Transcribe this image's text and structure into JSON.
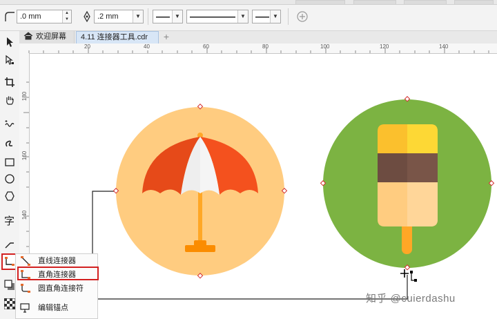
{
  "property_bar": {
    "corner_size": ".0 mm",
    "outline_width": ".2 mm"
  },
  "tabs": [
    {
      "label": "欢迎屏幕"
    },
    {
      "label": "4.11 连接器工具.cdr"
    }
  ],
  "ruler": {
    "h_labels": [
      "20",
      "40",
      "60",
      "80",
      "100",
      "120",
      "140"
    ],
    "v_labels": [
      "180",
      "160",
      "140"
    ]
  },
  "toolbox": {
    "tools": [
      "pick-tool",
      "shape-tool",
      "crop-tool",
      "pan-tool",
      "freehand-tool",
      "artistic-media-tool",
      "rectangle-tool",
      "ellipse-tool",
      "polygon-tool",
      "text-tool",
      "dimension-tool",
      "connector-tool",
      "drop-shadow-tool",
      "transparency-tool"
    ]
  },
  "flyout": {
    "items": [
      {
        "label": "直线连接器"
      },
      {
        "label": "直角连接器"
      },
      {
        "label": "圆直角连接符"
      },
      {
        "label": "编辑锚点"
      }
    ]
  },
  "colors": {
    "umbrella_bg": "#ffcc80",
    "popsicle_bg": "#7cb342",
    "connector_line": "#222222",
    "highlight": "#d21f1f"
  },
  "watermark": "知乎 @cuierdashu"
}
